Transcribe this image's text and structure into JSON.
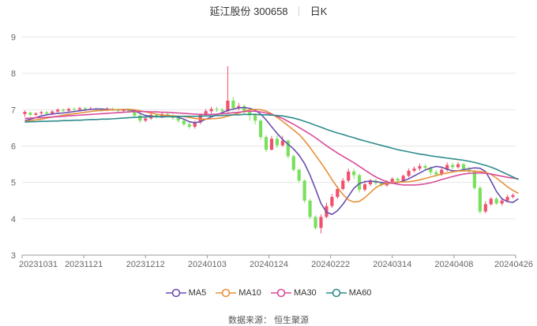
{
  "header": {
    "name_code": "延江股份 300658",
    "period": "日K"
  },
  "source": "数据来源： 恒生聚源",
  "chart_data": {
    "type": "candlestick",
    "title": "延江股份 300658",
    "subtitle": "日K",
    "ylim": [
      3,
      9
    ],
    "yticks": [
      "3",
      "4",
      "5",
      "6",
      "7",
      "8",
      "9"
    ],
    "xtick_labels": [
      "20231031",
      "20231121",
      "20231212",
      "20240103",
      "20240124",
      "20240222",
      "20240314",
      "20240408",
      "20240426"
    ],
    "grid": true,
    "legend_position": "bottom-center",
    "colors": {
      "up": "#f0506e",
      "down": "#78e05a",
      "MA5": "#6a4fb0",
      "MA10": "#e8903a",
      "MA30": "#d94c9a",
      "MA60": "#2e8b8b"
    },
    "candles": [
      [
        6.88,
        6.94,
        6.8,
        6.98
      ],
      [
        6.92,
        6.86,
        6.82,
        6.95
      ],
      [
        6.86,
        6.9,
        6.83,
        6.93
      ],
      [
        6.9,
        6.93,
        6.86,
        6.97
      ],
      [
        6.93,
        6.89,
        6.85,
        6.96
      ],
      [
        6.89,
        6.95,
        6.87,
        6.99
      ],
      [
        6.95,
        7.0,
        6.92,
        7.04
      ],
      [
        7.0,
        6.97,
        6.94,
        7.03
      ],
      [
        6.97,
        7.02,
        6.95,
        7.06
      ],
      [
        7.02,
        7.0,
        6.96,
        7.07
      ],
      [
        7.0,
        7.04,
        6.98,
        7.08
      ],
      [
        7.04,
        7.01,
        6.97,
        7.07
      ],
      [
        7.01,
        7.03,
        6.99,
        7.08
      ],
      [
        7.03,
        7.0,
        6.96,
        7.06
      ],
      [
        7.0,
        6.98,
        6.94,
        7.04
      ],
      [
        6.98,
        7.03,
        6.96,
        7.07
      ],
      [
        7.03,
        7.01,
        6.97,
        7.06
      ],
      [
        7.01,
        6.97,
        6.93,
        7.04
      ],
      [
        6.97,
        7.0,
        6.94,
        7.03
      ],
      [
        7.0,
        6.96,
        6.91,
        7.02
      ],
      [
        6.96,
        6.84,
        6.79,
        6.98
      ],
      [
        6.84,
        6.7,
        6.64,
        6.88
      ],
      [
        6.7,
        6.76,
        6.66,
        6.82
      ],
      [
        6.76,
        6.86,
        6.72,
        6.9
      ],
      [
        6.86,
        6.8,
        6.75,
        6.9
      ],
      [
        6.8,
        6.88,
        6.77,
        6.92
      ],
      [
        6.88,
        6.84,
        6.79,
        6.93
      ],
      [
        6.84,
        6.77,
        6.72,
        6.88
      ],
      [
        6.77,
        6.7,
        6.64,
        6.8
      ],
      [
        6.7,
        6.6,
        6.55,
        6.74
      ],
      [
        6.6,
        6.53,
        6.48,
        6.66
      ],
      [
        6.53,
        6.65,
        6.48,
        6.7
      ],
      [
        6.65,
        6.86,
        6.6,
        6.9
      ],
      [
        6.86,
        6.96,
        6.82,
        7.02
      ],
      [
        6.96,
        7.02,
        6.9,
        7.08
      ],
      [
        7.02,
        7.0,
        6.94,
        7.08
      ],
      [
        7.0,
        6.96,
        6.88,
        7.05
      ],
      [
        6.96,
        7.25,
        6.9,
        8.2
      ],
      [
        7.25,
        7.05,
        6.98,
        7.35
      ],
      [
        7.05,
        7.1,
        6.98,
        7.18
      ],
      [
        7.1,
        6.95,
        6.88,
        7.14
      ],
      [
        6.95,
        6.85,
        6.7,
        7.0
      ],
      [
        6.85,
        6.7,
        6.6,
        6.9
      ],
      [
        6.7,
        6.25,
        6.18,
        6.74
      ],
      [
        6.25,
        5.9,
        5.84,
        6.3
      ],
      [
        5.9,
        6.2,
        5.88,
        6.28
      ],
      [
        6.2,
        6.02,
        5.95,
        6.3
      ],
      [
        6.02,
        6.15,
        5.98,
        6.28
      ],
      [
        6.15,
        5.72,
        5.66,
        6.18
      ],
      [
        5.72,
        5.35,
        5.3,
        5.76
      ],
      [
        5.35,
        5.05,
        5.0,
        5.38
      ],
      [
        5.05,
        4.5,
        4.44,
        5.08
      ],
      [
        4.5,
        4.05,
        4.0,
        4.55
      ],
      [
        4.05,
        3.75,
        3.7,
        4.1
      ],
      [
        3.75,
        4.05,
        3.6,
        4.12
      ],
      [
        4.05,
        4.35,
        4.02,
        4.45
      ],
      [
        4.35,
        4.6,
        4.3,
        4.68
      ],
      [
        4.6,
        4.82,
        4.55,
        4.9
      ],
      [
        4.82,
        5.05,
        4.78,
        5.12
      ],
      [
        5.05,
        5.3,
        5.0,
        5.38
      ],
      [
        5.3,
        5.2,
        5.1,
        5.38
      ],
      [
        5.2,
        4.8,
        4.72,
        5.24
      ],
      [
        4.8,
        4.95,
        4.75,
        5.05
      ],
      [
        4.95,
        5.05,
        4.9,
        5.1
      ],
      [
        5.05,
        4.98,
        4.92,
        5.1
      ],
      [
        4.98,
        4.92,
        4.88,
        5.02
      ],
      [
        4.92,
        5.02,
        4.88,
        5.06
      ],
      [
        5.02,
        5.1,
        4.98,
        5.14
      ],
      [
        5.1,
        5.05,
        5.0,
        5.14
      ],
      [
        5.05,
        5.18,
        5.02,
        5.22
      ],
      [
        5.18,
        5.32,
        5.14,
        5.38
      ],
      [
        5.32,
        5.38,
        5.28,
        5.44
      ],
      [
        5.38,
        5.45,
        5.32,
        5.52
      ],
      [
        5.45,
        5.4,
        5.34,
        5.5
      ],
      [
        5.4,
        5.28,
        5.2,
        5.44
      ],
      [
        5.28,
        5.22,
        5.16,
        5.34
      ],
      [
        5.22,
        5.35,
        5.18,
        5.4
      ],
      [
        5.35,
        5.48,
        5.3,
        5.55
      ],
      [
        5.48,
        5.42,
        5.36,
        5.54
      ],
      [
        5.42,
        5.5,
        5.38,
        5.56
      ],
      [
        5.5,
        5.36,
        5.3,
        5.54
      ],
      [
        5.36,
        5.3,
        5.24,
        5.42
      ],
      [
        5.3,
        4.85,
        4.8,
        5.34
      ],
      [
        4.85,
        4.2,
        4.14,
        4.9
      ],
      [
        4.2,
        4.4,
        4.15,
        4.48
      ],
      [
        4.4,
        4.55,
        4.36,
        4.6
      ],
      [
        4.55,
        4.42,
        4.38,
        4.6
      ],
      [
        4.42,
        4.5,
        4.36,
        4.56
      ],
      [
        4.5,
        4.6,
        4.46,
        4.66
      ],
      [
        4.6,
        4.65,
        4.56,
        4.7
      ]
    ],
    "series": [
      {
        "name": "MA5",
        "values": [
          6.7,
          6.74,
          6.78,
          6.83,
          6.86,
          6.88,
          6.9,
          6.91,
          6.93,
          6.95,
          6.97,
          6.99,
          7.01,
          7.02,
          7.02,
          7.01,
          7.0,
          7.0,
          7.0,
          7.0,
          6.97,
          6.9,
          6.84,
          6.82,
          6.81,
          6.8,
          6.81,
          6.82,
          6.79,
          6.74,
          6.67,
          6.64,
          6.67,
          6.74,
          6.8,
          6.86,
          6.92,
          6.98,
          7.02,
          7.05,
          7.06,
          7.04,
          6.99,
          6.88,
          6.72,
          6.53,
          6.35,
          6.18,
          6.05,
          5.92,
          5.75,
          5.52,
          5.2,
          4.82,
          4.42,
          4.18,
          4.12,
          4.22,
          4.4,
          4.62,
          4.84,
          4.97,
          5.02,
          5.04,
          5.02,
          5.0,
          4.98,
          4.98,
          5.0,
          5.04,
          5.1,
          5.18,
          5.26,
          5.34,
          5.4,
          5.44,
          5.42,
          5.36,
          5.32,
          5.32,
          5.35,
          5.38,
          5.4,
          5.39,
          5.3,
          5.04,
          4.75,
          4.55,
          4.47,
          4.45,
          4.55
        ]
      },
      {
        "name": "MA10",
        "values": [
          6.68,
          6.7,
          6.72,
          6.74,
          6.77,
          6.8,
          6.82,
          6.85,
          6.87,
          6.89,
          6.91,
          6.93,
          6.95,
          6.97,
          6.98,
          6.99,
          7.0,
          7.0,
          7.01,
          7.01,
          7.0,
          6.97,
          6.94,
          6.91,
          6.88,
          6.85,
          6.84,
          6.83,
          6.82,
          6.81,
          6.79,
          6.76,
          6.74,
          6.74,
          6.75,
          6.76,
          6.78,
          6.82,
          6.86,
          6.91,
          6.96,
          7.0,
          7.01,
          7.0,
          6.96,
          6.89,
          6.79,
          6.68,
          6.56,
          6.44,
          6.32,
          6.15,
          5.96,
          5.75,
          5.54,
          5.32,
          5.08,
          4.86,
          4.67,
          4.52,
          4.46,
          4.48,
          4.58,
          4.72,
          4.86,
          4.94,
          4.98,
          5.0,
          5.01,
          5.01,
          5.02,
          5.04,
          5.07,
          5.11,
          5.15,
          5.19,
          5.23,
          5.26,
          5.29,
          5.31,
          5.32,
          5.32,
          5.31,
          5.3,
          5.28,
          5.22,
          5.12,
          5.0,
          4.88,
          4.78,
          4.7
        ]
      },
      {
        "name": "MA30",
        "values": [
          6.76,
          6.77,
          6.78,
          6.78,
          6.79,
          6.8,
          6.81,
          6.82,
          6.83,
          6.84,
          6.85,
          6.86,
          6.87,
          6.88,
          6.89,
          6.9,
          6.91,
          6.92,
          6.93,
          6.94,
          6.95,
          6.95,
          6.95,
          6.94,
          6.94,
          6.93,
          6.93,
          6.92,
          6.91,
          6.9,
          6.89,
          6.88,
          6.87,
          6.87,
          6.87,
          6.88,
          6.89,
          6.9,
          6.92,
          6.93,
          6.95,
          6.96,
          6.96,
          6.94,
          6.91,
          6.87,
          6.82,
          6.76,
          6.68,
          6.6,
          6.51,
          6.42,
          6.33,
          6.23,
          6.12,
          6.01,
          5.91,
          5.81,
          5.72,
          5.63,
          5.54,
          5.44,
          5.34,
          5.24,
          5.15,
          5.08,
          5.02,
          4.98,
          4.95,
          4.93,
          4.93,
          4.93,
          4.94,
          4.96,
          4.99,
          5.03,
          5.08,
          5.12,
          5.16,
          5.2,
          5.23,
          5.25,
          5.26,
          5.26,
          5.25,
          5.23,
          5.2,
          5.17,
          5.14,
          5.12,
          5.1
        ]
      },
      {
        "name": "MA60",
        "values": [
          6.66,
          6.67,
          6.67,
          6.68,
          6.68,
          6.69,
          6.69,
          6.7,
          6.7,
          6.71,
          6.71,
          6.72,
          6.73,
          6.73,
          6.74,
          6.74,
          6.75,
          6.76,
          6.77,
          6.78,
          6.79,
          6.8,
          6.8,
          6.81,
          6.81,
          6.81,
          6.81,
          6.81,
          6.82,
          6.82,
          6.82,
          6.82,
          6.82,
          6.83,
          6.83,
          6.84,
          6.84,
          6.85,
          6.86,
          6.86,
          6.87,
          6.87,
          6.87,
          6.86,
          6.86,
          6.85,
          6.84,
          6.83,
          6.8,
          6.77,
          6.73,
          6.68,
          6.63,
          6.57,
          6.52,
          6.46,
          6.41,
          6.36,
          6.32,
          6.27,
          6.23,
          6.18,
          6.14,
          6.1,
          6.06,
          6.02,
          5.98,
          5.94,
          5.9,
          5.87,
          5.84,
          5.81,
          5.78,
          5.76,
          5.73,
          5.71,
          5.69,
          5.67,
          5.65,
          5.63,
          5.61,
          5.58,
          5.55,
          5.51,
          5.47,
          5.42,
          5.36,
          5.29,
          5.22,
          5.15,
          5.08
        ]
      }
    ]
  }
}
